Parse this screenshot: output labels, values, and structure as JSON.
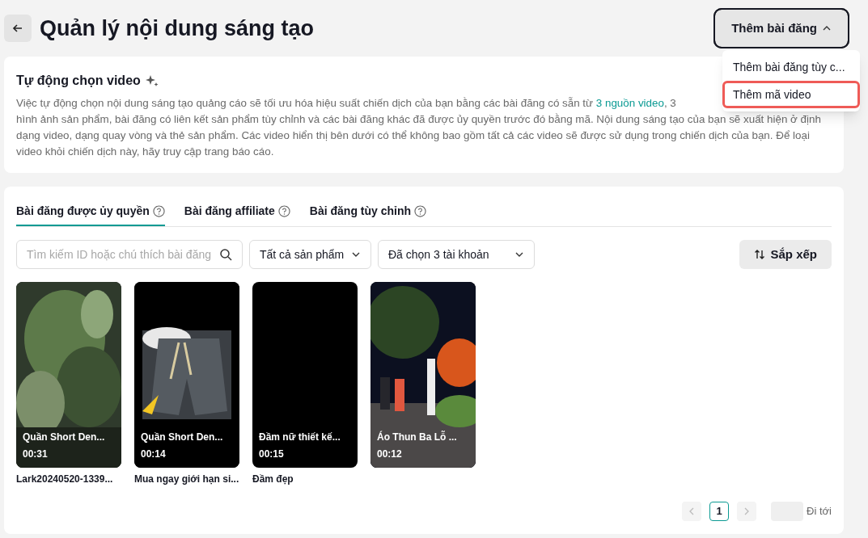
{
  "header": {
    "title": "Quản lý nội dung sáng tạo",
    "add_button": {
      "label": "Thêm bài đăng",
      "expanded": true
    }
  },
  "add_menu": [
    {
      "label": "Thêm bài đăng tùy c...",
      "highlighted": false
    },
    {
      "label": "Thêm mã video",
      "highlighted": true
    }
  ],
  "auto_select": {
    "title": "Tự động chọn video",
    "text_before_link": "Việc tự động chọn nội dung sáng tạo quảng cáo sẽ tối ưu hóa hiệu suất chiến dịch của bạn bằng các bài đăng có sẵn từ ",
    "link": "3 nguồn video",
    "text_after_link": ", 3",
    "text_rest": "hình ảnh sản phẩm, bài đăng có liên kết sản phẩm tùy chỉnh và các bài đăng khác đã được ủy quyền trước đó bằng mã. Nội dung sáng tạo của bạn sẽ xuất hiện ở định dạng video, dạng quay vòng và thẻ sản phẩm. Các video hiển thị bên dưới có thể không bao gồm tất cả các video sẽ được sử dụng trong chiến dịch của bạn. Để loại video khỏi chiến dịch này, hãy truy cập trang báo cáo."
  },
  "tabs": [
    {
      "label": "Bài đăng được ủy quyền",
      "selected": true
    },
    {
      "label": "Bài đăng affiliate",
      "selected": false
    },
    {
      "label": "Bài đăng tùy chỉnh",
      "selected": false
    }
  ],
  "search": {
    "placeholder": "Tìm kiếm ID hoặc chú thích bài đăng"
  },
  "product_filter": "Tất cả sản phẩm",
  "account_filter": "Đã chọn 3 tài khoản",
  "sort_button": "Sắp xếp",
  "videos": [
    {
      "kind": "picture",
      "title": "Quần Short Den...",
      "duration": "00:31",
      "caption": "Lark20240520-1339..."
    },
    {
      "kind": "picture",
      "title": "Quần Short Den...",
      "duration": "00:14",
      "caption": "Mua ngay giới hạn si..."
    },
    {
      "kind": "blank",
      "title": "Đầm nữ thiết kế...",
      "duration": "00:15",
      "caption": "Đầm đẹp"
    },
    {
      "kind": "picture",
      "title": "Áo Thun Ba Lỗ ...",
      "duration": "00:12"
    }
  ],
  "pagination": {
    "pages": [
      {
        "label": "1",
        "selected": true
      }
    ],
    "goto_label": "Đi tới"
  }
}
